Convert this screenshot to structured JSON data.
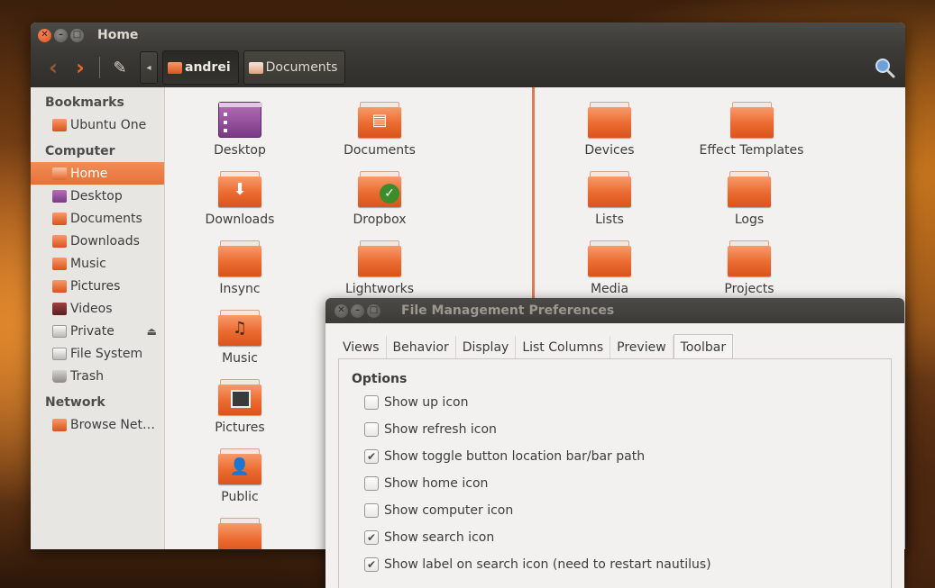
{
  "window": {
    "title": "Home",
    "controls": [
      "close",
      "minimize",
      "maximize"
    ]
  },
  "toolbar": {
    "back_icon": "chevron-left-icon",
    "forward_icon": "chevron-right-icon",
    "edit_icon": "pencil-icon",
    "breadcrumbs": [
      "andrei",
      "Documents"
    ],
    "search_icon": "search-icon"
  },
  "sidebar": {
    "sections": [
      {
        "title": "Bookmarks",
        "items": [
          {
            "label": "Ubuntu One",
            "icon": "folder-icon"
          }
        ]
      },
      {
        "title": "Computer",
        "items": [
          {
            "label": "Home",
            "icon": "home-folder-icon",
            "selected": true
          },
          {
            "label": "Desktop",
            "icon": "desktop-icon"
          },
          {
            "label": "Documents",
            "icon": "documents-icon"
          },
          {
            "label": "Downloads",
            "icon": "downloads-icon"
          },
          {
            "label": "Music",
            "icon": "music-icon"
          },
          {
            "label": "Pictures",
            "icon": "pictures-icon"
          },
          {
            "label": "Videos",
            "icon": "videos-icon"
          },
          {
            "label": "Private",
            "icon": "drive-icon",
            "eject": true
          },
          {
            "label": "File System",
            "icon": "drive-icon"
          },
          {
            "label": "Trash",
            "icon": "trash-icon"
          }
        ]
      },
      {
        "title": "Network",
        "items": [
          {
            "label": "Browse Net…",
            "icon": "network-icon"
          }
        ]
      }
    ]
  },
  "left_pane": {
    "files": [
      "Desktop",
      "Documents",
      "Downloads",
      "Dropbox",
      "Insync",
      "Lightworks",
      "Music",
      "Pictures",
      "Public",
      ""
    ]
  },
  "right_pane": {
    "files": [
      "Devices",
      "Effect Templates",
      "Lists",
      "Logs",
      "Media",
      "Projects"
    ]
  },
  "dialog": {
    "title": "File Management Preferences",
    "tabs": [
      "Views",
      "Behavior",
      "Display",
      "List Columns",
      "Preview",
      "Toolbar"
    ],
    "active_tab": "Toolbar",
    "section_title": "Options",
    "options": [
      {
        "label": "Show up icon",
        "checked": false
      },
      {
        "label": "Show refresh icon",
        "checked": false
      },
      {
        "label": "Show toggle button location bar/bar path",
        "checked": true
      },
      {
        "label": "Show home icon",
        "checked": false
      },
      {
        "label": "Show computer icon",
        "checked": false
      },
      {
        "label": "Show search icon",
        "checked": true
      },
      {
        "label": "Show label on search icon (need to restart nautilus)",
        "checked": true
      }
    ]
  },
  "colors": {
    "accent": "#e5723a",
    "folder": "#ea6a2f",
    "titlebar": "#3c3b37"
  }
}
